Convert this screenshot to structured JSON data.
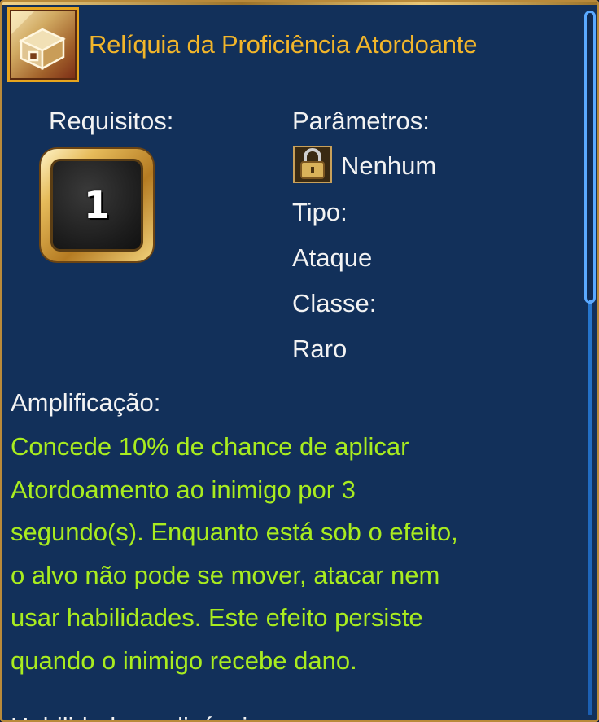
{
  "item": {
    "title": "Relíquia da Proficiência Atordoante",
    "icon": "relic-chest-icon"
  },
  "requirements": {
    "label": "Requisitos:",
    "level": "1"
  },
  "parameters": {
    "label": "Parâmetros:",
    "lock_icon": "padlock-icon",
    "lock_value": "Nenhum",
    "type_label": "Tipo:",
    "type_value": "Ataque",
    "class_label": "Classe:",
    "class_value": "Raro"
  },
  "amplification": {
    "label": "Amplificação:",
    "description": "Concede 10% de chance de aplicar\nAtordoamento ao inimigo por 3\nsegundo(s). Enquanto está sob o efeito,\no alvo não pode se mover, atacar nem\nusar habilidades. Este efeito persiste\nquando o inimigo recebe dano."
  },
  "next_section": {
    "label": "Habilidades aplicáveis:"
  },
  "colors": {
    "title": "#f2b52a",
    "label": "#f3f3f3",
    "description": "#a9ec1f",
    "background": "#12305a",
    "scrollbar": "#5aa9ff"
  }
}
